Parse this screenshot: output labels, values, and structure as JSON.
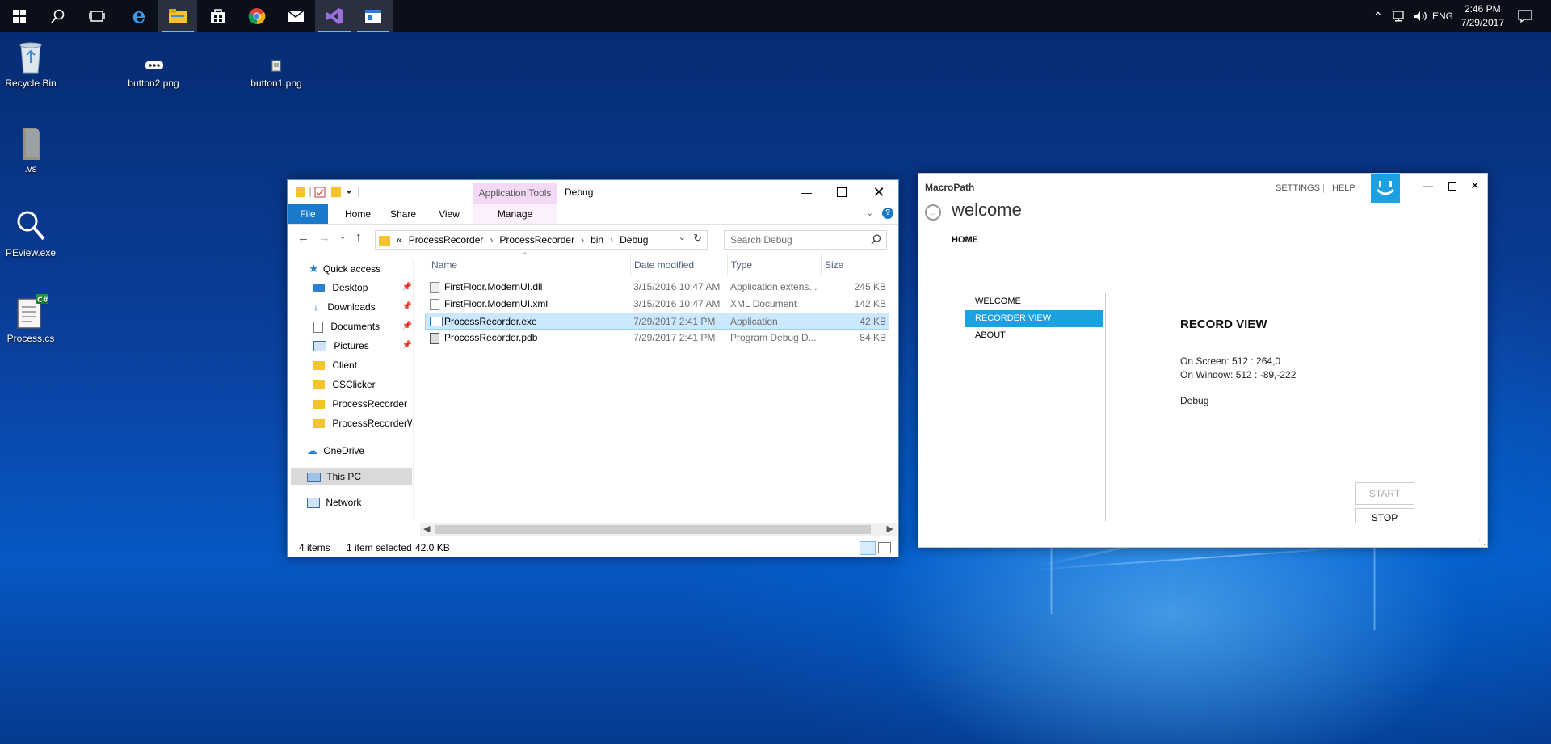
{
  "taskbar": {
    "apps": [
      "start",
      "search",
      "task-view",
      "edge",
      "file-explorer",
      "store",
      "chrome",
      "mail",
      "visual-studio",
      "app"
    ],
    "tray": {
      "language": "ENG"
    },
    "clock": {
      "time": "2:46 PM",
      "date": "7/29/2017"
    }
  },
  "desktop": {
    "icons": [
      {
        "label": "Recycle Bin"
      },
      {
        "label": "button2.png"
      },
      {
        "label": "button1.png"
      },
      {
        "label": ".vs"
      },
      {
        "label": "PEview.exe"
      },
      {
        "label": "Process.cs"
      }
    ]
  },
  "explorer": {
    "title": "Debug",
    "context_tab": "Application Tools",
    "tabs": {
      "file": "File",
      "home": "Home",
      "share": "Share",
      "view": "View",
      "manage": "Manage"
    },
    "address": {
      "overflow": "«",
      "crumbs": [
        "ProcessRecorder",
        "ProcessRecorder",
        "bin",
        "Debug"
      ]
    },
    "search_placeholder": "Search Debug",
    "nav": {
      "quick_access": "Quick access",
      "pinned": [
        "Desktop",
        "Downloads",
        "Documents",
        "Pictures"
      ],
      "folders": [
        "Client",
        "CSClicker",
        "ProcessRecorder",
        "ProcessRecorderWP"
      ],
      "onedrive": "OneDrive",
      "this_pc": "This PC",
      "network": "Network"
    },
    "columns": {
      "name": "Name",
      "date": "Date modified",
      "type": "Type",
      "size": "Size"
    },
    "files": [
      {
        "name": "FirstFloor.ModernUI.dll",
        "date": "3/15/2016 10:47 AM",
        "type": "Application extens...",
        "size": "245 KB"
      },
      {
        "name": "FirstFloor.ModernUI.xml",
        "date": "3/15/2016 10:47 AM",
        "type": "XML Document",
        "size": "142 KB"
      },
      {
        "name": "ProcessRecorder.exe",
        "date": "7/29/2017 2:41 PM",
        "type": "Application",
        "size": "42 KB"
      },
      {
        "name": "ProcessRecorder.pdb",
        "date": "7/29/2017 2:41 PM",
        "type": "Program Debug D...",
        "size": "84 KB"
      }
    ],
    "status": {
      "items": "4 items",
      "selected": "1 item selected",
      "size": "42.0 KB"
    }
  },
  "macropath": {
    "app_title": "MacroPath",
    "links": {
      "settings": "SETTINGS",
      "sep": "|",
      "help": "HELP"
    },
    "page_title": "welcome",
    "subnav": "HOME",
    "menu": [
      "WELCOME",
      "RECORDER VIEW",
      "ABOUT"
    ],
    "content": {
      "heading": "RECORD VIEW",
      "on_screen": "On Screen: 512 : 264,0",
      "on_window": "On Window: 512 : -89,-222",
      "mode": "Debug"
    },
    "buttons": {
      "start": "START",
      "stop": "STOP"
    }
  }
}
